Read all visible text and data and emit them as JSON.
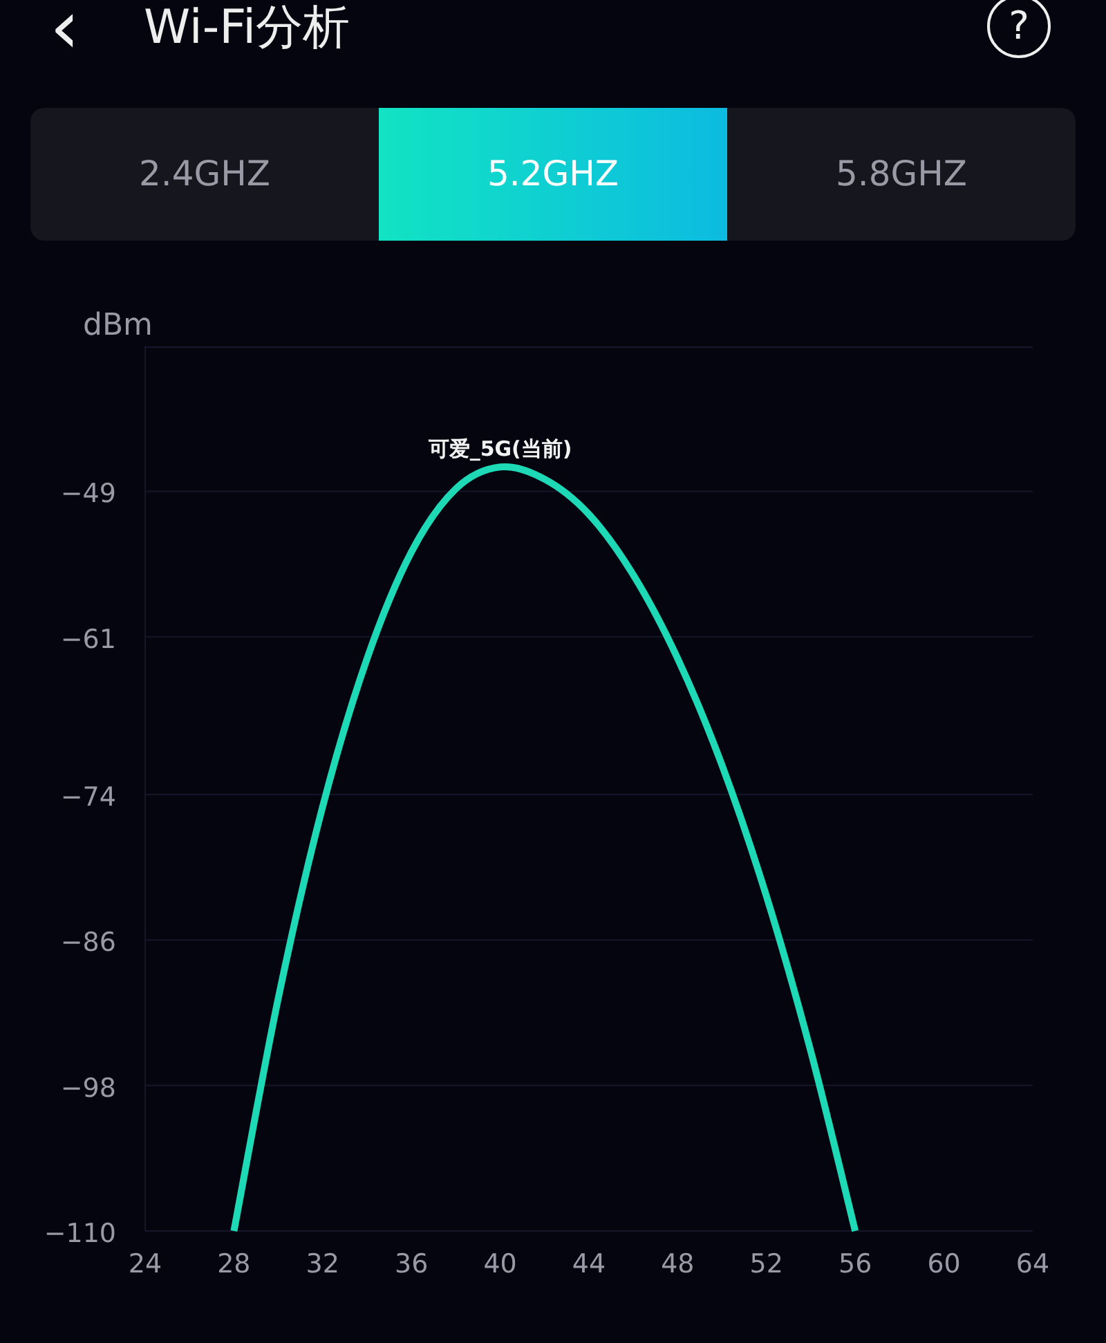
{
  "header": {
    "back_icon": "‹",
    "title": "Wi-Fi分析",
    "help_icon": "?"
  },
  "tabs": [
    {
      "label": "2.4GHZ",
      "selected": false
    },
    {
      "label": "5.2GHZ",
      "selected": true
    },
    {
      "label": "5.8GHZ",
      "selected": false
    }
  ],
  "chart": {
    "chart_data": {
      "type": "line",
      "grid": true,
      "ylabel": "dBm",
      "xlim": [
        24,
        64
      ],
      "ylim": [
        -110,
        -37
      ],
      "xticks": [
        24,
        28,
        32,
        36,
        40,
        44,
        48,
        52,
        56,
        60,
        64
      ],
      "yticks": [
        {
          "value": -49,
          "label": "−49"
        },
        {
          "value": -61,
          "label": "−61"
        },
        {
          "value": -74,
          "label": "−74"
        },
        {
          "value": -86,
          "label": "−86"
        },
        {
          "value": -98,
          "label": "−98"
        },
        {
          "value": -110,
          "label": "−110"
        }
      ],
      "x": [
        28,
        30,
        32,
        34,
        36,
        38,
        40,
        42,
        44,
        46,
        48,
        50,
        52,
        54,
        56
      ],
      "series": [
        {
          "name": "可爱_5G(当前)",
          "color": "#1ed9b5",
          "values": [
            -110,
            -90.8,
            -75,
            -62.8,
            -54,
            -48.8,
            -47,
            -48,
            -50.9,
            -55.9,
            -62.8,
            -71.6,
            -82.4,
            -95.2,
            -110
          ]
        }
      ]
    }
  }
}
